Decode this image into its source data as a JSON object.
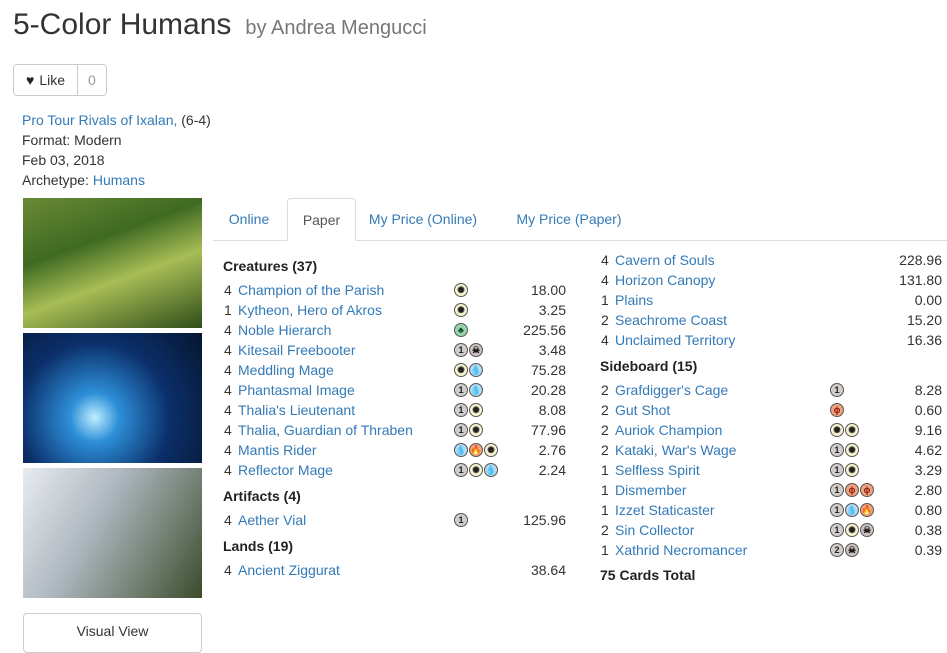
{
  "deck": {
    "title": "5-Color Humans",
    "author_line": "by Andrea Mengucci"
  },
  "like": {
    "label": "Like",
    "count": "0"
  },
  "meta": {
    "event": "Pro Tour Rivals of Ixalan,",
    "record": "(6-4)",
    "format_label": "Format:",
    "format": "Modern",
    "date": "Feb 03, 2018",
    "archetype_label": "Archetype:",
    "archetype": "Humans"
  },
  "visual_view": "Visual View",
  "tabs": [
    "Online",
    "Paper",
    "My Price (Online)",
    "My Price (Paper)"
  ],
  "active_tab": "Paper",
  "sections": {
    "creatures": "Creatures (37)",
    "artifacts": "Artifacts (4)",
    "lands": "Lands (19)",
    "sideboard": "Sideboard (15)"
  },
  "creatures": [
    {
      "qty": "4",
      "name": "Champion of the Parish",
      "mana": [
        "W"
      ],
      "price": "18.00"
    },
    {
      "qty": "1",
      "name": "Kytheon, Hero of Akros",
      "mana": [
        "W"
      ],
      "price": "3.25"
    },
    {
      "qty": "4",
      "name": "Noble Hierarch",
      "mana": [
        "G"
      ],
      "price": "225.56"
    },
    {
      "qty": "4",
      "name": "Kitesail Freebooter",
      "mana": [
        "1",
        "B"
      ],
      "price": "3.48"
    },
    {
      "qty": "4",
      "name": "Meddling Mage",
      "mana": [
        "W",
        "U"
      ],
      "price": "75.28"
    },
    {
      "qty": "4",
      "name": "Phantasmal Image",
      "mana": [
        "1",
        "U"
      ],
      "price": "20.28"
    },
    {
      "qty": "4",
      "name": "Thalia's Lieutenant",
      "mana": [
        "1",
        "W"
      ],
      "price": "8.08"
    },
    {
      "qty": "4",
      "name": "Thalia, Guardian of Thraben",
      "mana": [
        "1",
        "W"
      ],
      "price": "77.96"
    },
    {
      "qty": "4",
      "name": "Mantis Rider",
      "mana": [
        "U",
        "R",
        "W"
      ],
      "price": "2.76"
    },
    {
      "qty": "4",
      "name": "Reflector Mage",
      "mana": [
        "1",
        "W",
        "U"
      ],
      "price": "2.24"
    }
  ],
  "artifacts": [
    {
      "qty": "4",
      "name": "Aether Vial",
      "mana": [
        "1"
      ],
      "price": "125.96"
    }
  ],
  "lands_left": [
    {
      "qty": "4",
      "name": "Ancient Ziggurat",
      "mana": [],
      "price": "38.64"
    }
  ],
  "lands_right": [
    {
      "qty": "4",
      "name": "Cavern of Souls",
      "mana": [],
      "price": "228.96"
    },
    {
      "qty": "4",
      "name": "Horizon Canopy",
      "mana": [],
      "price": "131.80"
    },
    {
      "qty": "1",
      "name": "Plains",
      "mana": [],
      "price": "0.00"
    },
    {
      "qty": "2",
      "name": "Seachrome Coast",
      "mana": [],
      "price": "15.20"
    },
    {
      "qty": "4",
      "name": "Unclaimed Territory",
      "mana": [],
      "price": "16.36"
    }
  ],
  "sideboard": [
    {
      "qty": "2",
      "name": "Grafdigger's Cage",
      "mana": [
        "1"
      ],
      "price": "8.28"
    },
    {
      "qty": "2",
      "name": "Gut Shot",
      "mana": [
        "P"
      ],
      "price": "0.60"
    },
    {
      "qty": "2",
      "name": "Auriok Champion",
      "mana": [
        "W",
        "W"
      ],
      "price": "9.16"
    },
    {
      "qty": "2",
      "name": "Kataki, War's Wage",
      "mana": [
        "1",
        "W"
      ],
      "price": "4.62"
    },
    {
      "qty": "1",
      "name": "Selfless Spirit",
      "mana": [
        "1",
        "W"
      ],
      "price": "3.29"
    },
    {
      "qty": "1",
      "name": "Dismember",
      "mana": [
        "1",
        "P",
        "P"
      ],
      "price": "2.80"
    },
    {
      "qty": "1",
      "name": "Izzet Staticaster",
      "mana": [
        "1",
        "U",
        "R"
      ],
      "price": "0.80"
    },
    {
      "qty": "2",
      "name": "Sin Collector",
      "mana": [
        "1",
        "W",
        "B"
      ],
      "price": "0.38"
    },
    {
      "qty": "1",
      "name": "Xathrid Necromancer",
      "mana": [
        "2",
        "B"
      ],
      "price": "0.39"
    }
  ],
  "total": "75 Cards Total",
  "mana_glyphs": {
    "W": "✺",
    "U": "💧",
    "B": "☠",
    "R": "🔥",
    "G": "♣",
    "P": "ϕ",
    "1": "1",
    "2": "2"
  },
  "mana_icon_names": {
    "W": "white-mana-icon",
    "U": "blue-mana-icon",
    "B": "black-mana-icon",
    "R": "red-mana-icon",
    "G": "green-mana-icon",
    "P": "phyrexian-mana-icon",
    "1": "generic-mana-icon",
    "2": "generic-mana-icon"
  }
}
